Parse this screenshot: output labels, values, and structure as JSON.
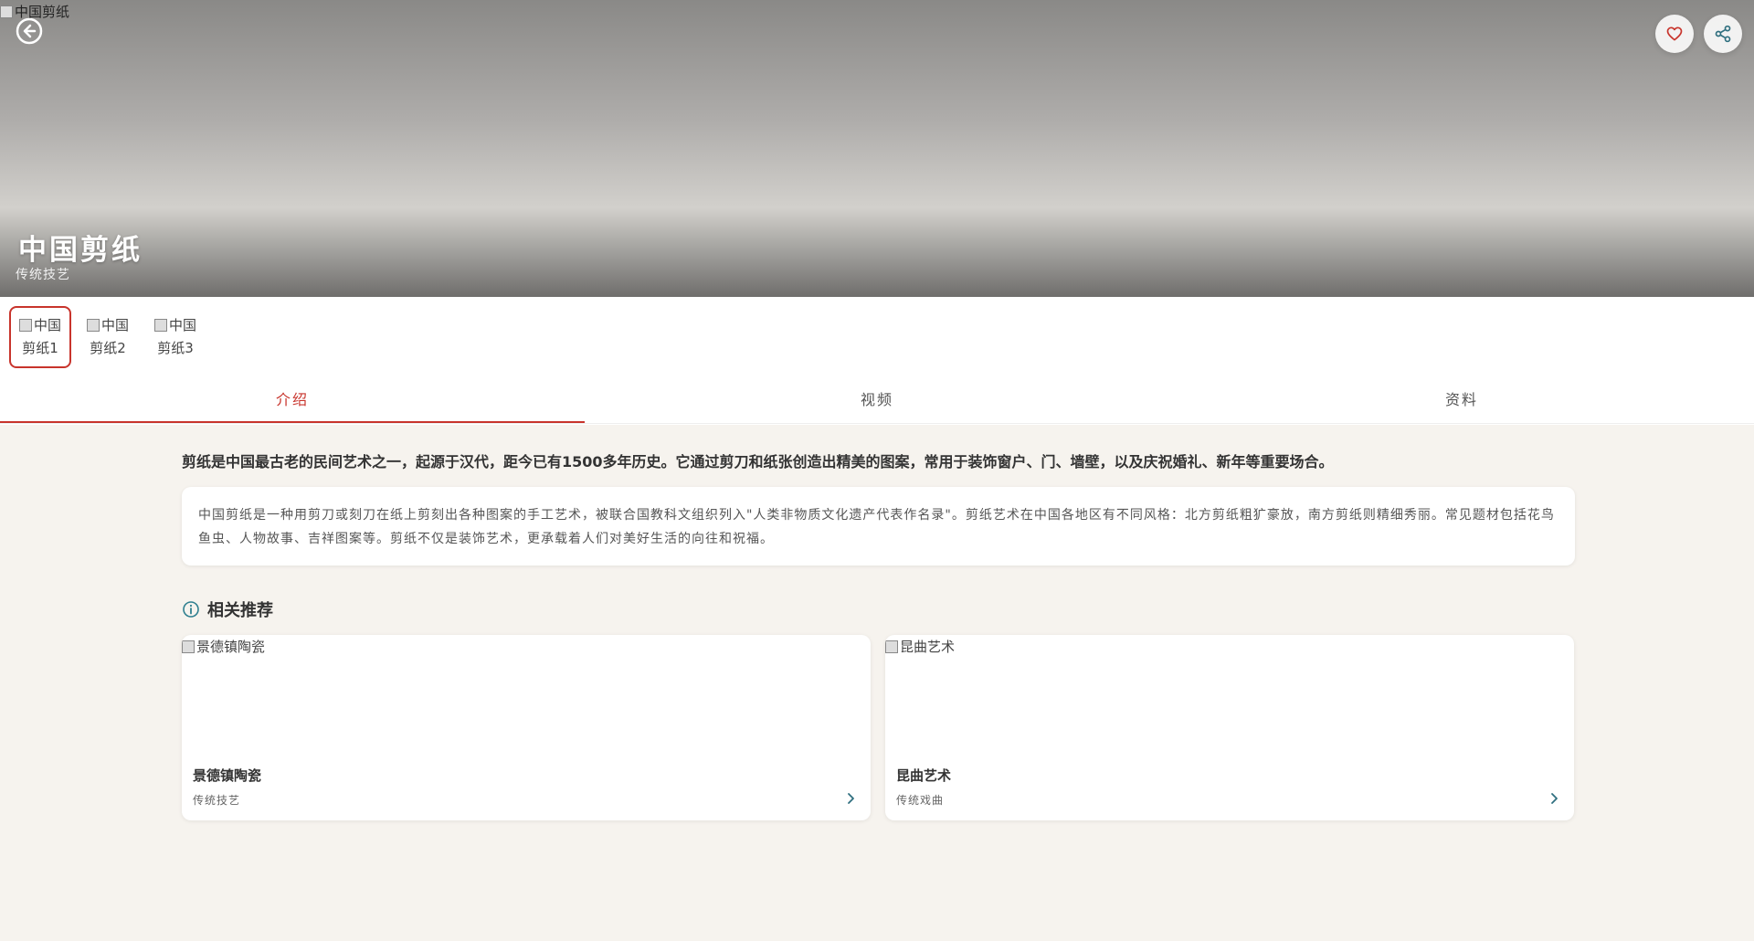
{
  "hero": {
    "image_alt": "中国剪纸",
    "title": "中国剪纸",
    "subtitle": "传统技艺",
    "back_icon": "arrow-left-circle-icon",
    "fav_icon": "heart-icon",
    "share_icon": "share-icon",
    "fav_color": "#c8342c",
    "share_color": "#2f6f7f"
  },
  "thumbnails": [
    {
      "alt": "中国剪纸1",
      "active": true
    },
    {
      "alt": "中国剪纸2",
      "active": false
    },
    {
      "alt": "中国剪纸3",
      "active": false
    }
  ],
  "tabs": [
    {
      "label": "介绍",
      "active": true
    },
    {
      "label": "视频",
      "active": false
    },
    {
      "label": "资料",
      "active": false
    }
  ],
  "intro": {
    "lead": "剪纸是中国最古老的民间艺术之一，起源于汉代，距今已有1500多年历史。它通过剪刀和纸张创造出精美的图案，常用于装饰窗户、门、墙壁，以及庆祝婚礼、新年等重要场合。",
    "description": "中国剪纸是一种用剪刀或刻刀在纸上剪刻出各种图案的手工艺术，被联合国教科文组织列入\"人类非物质文化遗产代表作名录\"。剪纸艺术在中国各地区有不同风格：北方剪纸粗犷豪放，南方剪纸则精细秀丽。常见题材包括花鸟鱼虫、人物故事、吉祥图案等。剪纸不仅是装饰艺术，更承载着人们对美好生活的向往和祝福。"
  },
  "related": {
    "title": "相关推荐",
    "icon": "info-circle-icon",
    "items": [
      {
        "image_alt": "景德镇陶瓷",
        "name": "景德镇陶瓷",
        "category": "传统技艺"
      },
      {
        "image_alt": "昆曲艺术",
        "name": "昆曲艺术",
        "category": "传统戏曲"
      }
    ]
  },
  "colors": {
    "accent": "#c8342c",
    "teal": "#2f7f8f",
    "background": "#f6f3ee"
  }
}
